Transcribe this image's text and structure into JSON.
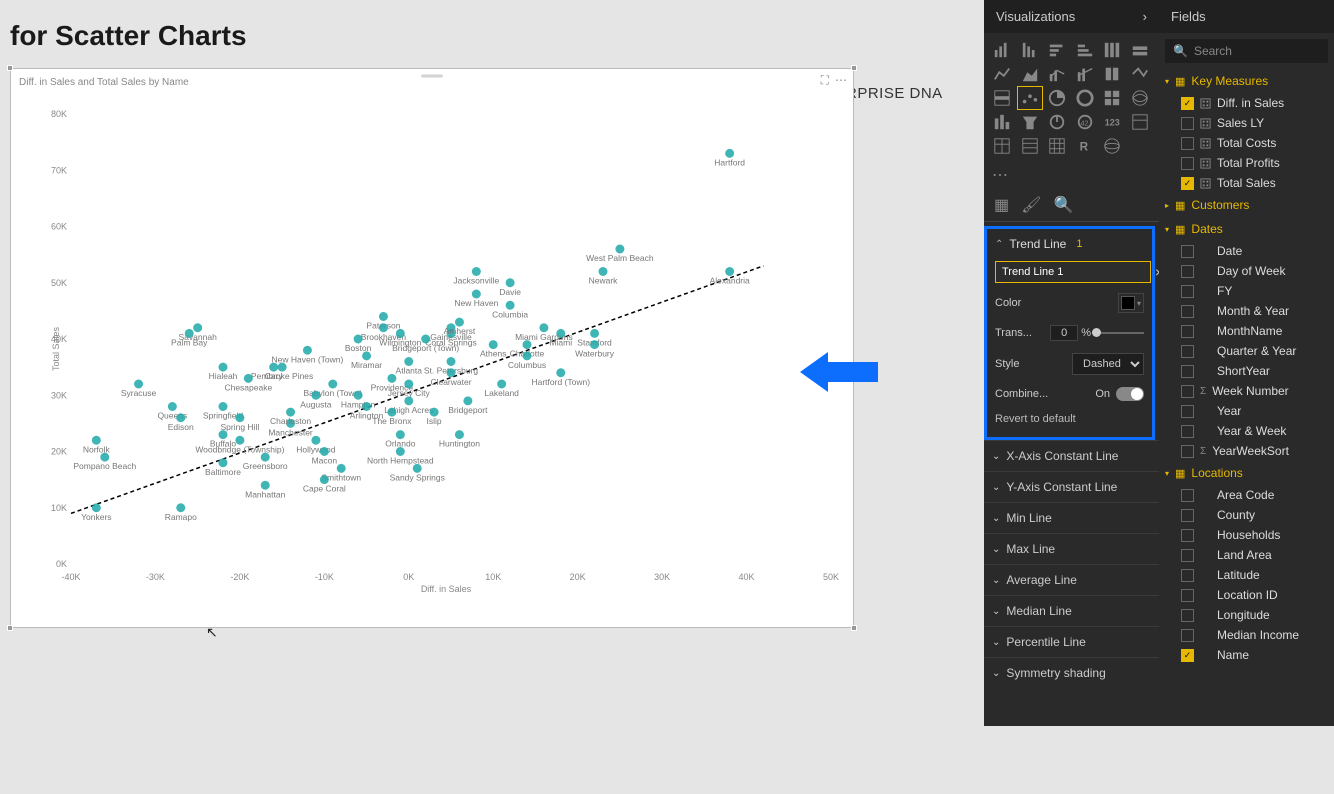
{
  "title": "for Scatter Charts",
  "logo_text": "ENTERPRISE DNA",
  "chart": {
    "subtitle": "Diff. in Sales and Total Sales by Name",
    "xlabel": "Diff. in Sales",
    "ylabel": "Total Sales"
  },
  "chart_data": {
    "type": "scatter",
    "xlabel": "Diff. in Sales",
    "ylabel": "Total Sales",
    "xlim": [
      -40000,
      50000
    ],
    "ylim": [
      0,
      80000
    ],
    "xticks": [
      -40000,
      -30000,
      -20000,
      -10000,
      0,
      10000,
      20000,
      30000,
      40000,
      50000
    ],
    "yticks": [
      0,
      10000,
      20000,
      30000,
      40000,
      50000,
      60000,
      70000,
      80000
    ],
    "xtick_labels": [
      "-40K",
      "-30K",
      "-20K",
      "-10K",
      "0K",
      "10K",
      "20K",
      "30K",
      "40K",
      "50K"
    ],
    "ytick_labels": [
      "0K",
      "10K",
      "20K",
      "30K",
      "40K",
      "50K",
      "60K",
      "70K",
      "80K"
    ],
    "trend_line": {
      "x1": -40000,
      "y1": 9000,
      "x2": 42000,
      "y2": 53000,
      "style": "dashed"
    },
    "points": [
      {
        "name": "Hartford",
        "x": 38000,
        "y": 73000
      },
      {
        "name": "West Palm Beach",
        "x": 25000,
        "y": 56000
      },
      {
        "name": "Newark",
        "x": 23000,
        "y": 52000
      },
      {
        "name": "Alexandria",
        "x": 38000,
        "y": 52000
      },
      {
        "name": "Jacksonville",
        "x": 8000,
        "y": 52000
      },
      {
        "name": "Davie",
        "x": 12000,
        "y": 50000
      },
      {
        "name": "New Haven",
        "x": 8000,
        "y": 48000
      },
      {
        "name": "Columbia",
        "x": 12000,
        "y": 46000
      },
      {
        "name": "Paterson",
        "x": -3000,
        "y": 44000
      },
      {
        "name": "Brookhaven",
        "x": -3000,
        "y": 42000
      },
      {
        "name": "Gainesville",
        "x": 5000,
        "y": 42000
      },
      {
        "name": "Miami Gardens",
        "x": 16000,
        "y": 42000
      },
      {
        "name": "Savannah",
        "x": -25000,
        "y": 42000
      },
      {
        "name": "Palm Bay",
        "x": -26000,
        "y": 41000
      },
      {
        "name": "Wilmington",
        "x": -1000,
        "y": 41000
      },
      {
        "name": "Coral Springs",
        "x": 5000,
        "y": 41000
      },
      {
        "name": "Miami",
        "x": 18000,
        "y": 41000
      },
      {
        "name": "Stamford",
        "x": 22000,
        "y": 41000
      },
      {
        "name": "Boston",
        "x": -6000,
        "y": 40000
      },
      {
        "name": "Bridgeport (Town)",
        "x": 2000,
        "y": 40000
      },
      {
        "name": "Athens",
        "x": 10000,
        "y": 39000
      },
      {
        "name": "Charlotte",
        "x": 14000,
        "y": 39000
      },
      {
        "name": "Waterbury",
        "x": 22000,
        "y": 39000
      },
      {
        "name": "New Haven (Town)",
        "x": -12000,
        "y": 38000
      },
      {
        "name": "Columbus",
        "x": 14000,
        "y": 37000
      },
      {
        "name": "Miramar",
        "x": -5000,
        "y": 37000
      },
      {
        "name": "Atlanta",
        "x": 0,
        "y": 36000
      },
      {
        "name": "St. Petersburg",
        "x": 5000,
        "y": 36000
      },
      {
        "name": "Hialeah",
        "x": -22000,
        "y": 35000
      },
      {
        "name": "Cary",
        "x": -16000,
        "y": 35000
      },
      {
        "name": "Pembroke Pines",
        "x": -15000,
        "y": 35000
      },
      {
        "name": "Clearwater",
        "x": 5000,
        "y": 34000
      },
      {
        "name": "Hartford (Town)",
        "x": 18000,
        "y": 34000
      },
      {
        "name": "Providence",
        "x": -2000,
        "y": 33000
      },
      {
        "name": "Chesapeake",
        "x": -19000,
        "y": 33000
      },
      {
        "name": "Babylon (Town)",
        "x": -9000,
        "y": 32000
      },
      {
        "name": "Jersey City",
        "x": 0,
        "y": 32000
      },
      {
        "name": "Lakeland",
        "x": 11000,
        "y": 32000
      },
      {
        "name": "Syracuse",
        "x": -32000,
        "y": 32000
      },
      {
        "name": "Augusta",
        "x": -11000,
        "y": 30000
      },
      {
        "name": "Amherst",
        "x": 6000,
        "y": 43000
      },
      {
        "name": "Hampton",
        "x": -6000,
        "y": 30000
      },
      {
        "name": "Lehigh Acres",
        "x": 0,
        "y": 29000
      },
      {
        "name": "Bridgeport",
        "x": 7000,
        "y": 29000
      },
      {
        "name": "Springfield",
        "x": -22000,
        "y": 28000
      },
      {
        "name": "Queens",
        "x": -28000,
        "y": 28000
      },
      {
        "name": "Arlington",
        "x": -5000,
        "y": 28000
      },
      {
        "name": "The Bronx",
        "x": -2000,
        "y": 27000
      },
      {
        "name": "Islip",
        "x": 3000,
        "y": 27000
      },
      {
        "name": "Edison",
        "x": -27000,
        "y": 26000
      },
      {
        "name": "Spring Hill",
        "x": -20000,
        "y": 26000
      },
      {
        "name": "Manchester",
        "x": -14000,
        "y": 25000
      },
      {
        "name": "Charleston",
        "x": -14000,
        "y": 27000
      },
      {
        "name": "Orlando",
        "x": -1000,
        "y": 23000
      },
      {
        "name": "Huntington",
        "x": 6000,
        "y": 23000
      },
      {
        "name": "Buffalo",
        "x": -22000,
        "y": 23000
      },
      {
        "name": "Hollywood",
        "x": -11000,
        "y": 22000
      },
      {
        "name": "Woodbridge (Township)",
        "x": -20000,
        "y": 22000
      },
      {
        "name": "Norfolk",
        "x": -37000,
        "y": 22000
      },
      {
        "name": "Macon",
        "x": -10000,
        "y": 20000
      },
      {
        "name": "North Hempstead",
        "x": -1000,
        "y": 20000
      },
      {
        "name": "Pompano Beach",
        "x": -36000,
        "y": 19000
      },
      {
        "name": "Greensboro",
        "x": -17000,
        "y": 19000
      },
      {
        "name": "Baltimore",
        "x": -22000,
        "y": 18000
      },
      {
        "name": "Smithtown",
        "x": -8000,
        "y": 17000
      },
      {
        "name": "Sandy Springs",
        "x": 1000,
        "y": 17000
      },
      {
        "name": "Cape Coral",
        "x": -10000,
        "y": 15000
      },
      {
        "name": "Manhattan",
        "x": -17000,
        "y": 14000
      },
      {
        "name": "Yonkers",
        "x": -37000,
        "y": 10000
      },
      {
        "name": "Ramapo",
        "x": -27000,
        "y": 10000
      }
    ]
  },
  "viz_panel": {
    "title": "Visualizations",
    "trend_section": "Trend Line",
    "trend_count": "1",
    "trend_name": "Trend Line 1",
    "color_label": "Color",
    "trans_label": "Trans...",
    "trans_value": "0",
    "trans_unit": "%",
    "style_label": "Style",
    "style_value": "Dashed",
    "combine_label": "Combine...",
    "combine_value": "On",
    "revert": "Revert to default",
    "sections": [
      "X-Axis Constant Line",
      "Y-Axis Constant Line",
      "Min Line",
      "Max Line",
      "Average Line",
      "Median Line",
      "Percentile Line",
      "Symmetry shading"
    ]
  },
  "fields_panel": {
    "title": "Fields",
    "search_placeholder": "Search",
    "groups": [
      {
        "name": "Key Measures",
        "type": "table",
        "items": [
          {
            "name": "Diff. in Sales",
            "checked": true,
            "calc": true
          },
          {
            "name": "Sales LY",
            "checked": false,
            "calc": true
          },
          {
            "name": "Total Costs",
            "checked": false,
            "calc": true
          },
          {
            "name": "Total Profits",
            "checked": false,
            "calc": true
          },
          {
            "name": "Total Sales",
            "checked": true,
            "calc": true
          }
        ]
      },
      {
        "name": "Customers",
        "type": "table",
        "items": []
      },
      {
        "name": "Dates",
        "type": "table",
        "items": [
          {
            "name": "Date",
            "checked": false
          },
          {
            "name": "Day of Week",
            "checked": false
          },
          {
            "name": "FY",
            "checked": false
          },
          {
            "name": "Month & Year",
            "checked": false
          },
          {
            "name": "MonthName",
            "checked": false
          },
          {
            "name": "Quarter & Year",
            "checked": false
          },
          {
            "name": "ShortYear",
            "checked": false
          },
          {
            "name": "Week Number",
            "checked": false,
            "sigma": true
          },
          {
            "name": "Year",
            "checked": false
          },
          {
            "name": "Year & Week",
            "checked": false
          },
          {
            "name": "YearWeekSort",
            "checked": false,
            "sigma": true
          }
        ]
      },
      {
        "name": "Locations",
        "type": "table",
        "items": [
          {
            "name": "Area Code",
            "checked": false
          },
          {
            "name": "County",
            "checked": false
          },
          {
            "name": "Households",
            "checked": false
          },
          {
            "name": "Land Area",
            "checked": false
          },
          {
            "name": "Latitude",
            "checked": false
          },
          {
            "name": "Location ID",
            "checked": false
          },
          {
            "name": "Longitude",
            "checked": false
          },
          {
            "name": "Median Income",
            "checked": false
          },
          {
            "name": "Name",
            "checked": true
          }
        ]
      }
    ]
  }
}
